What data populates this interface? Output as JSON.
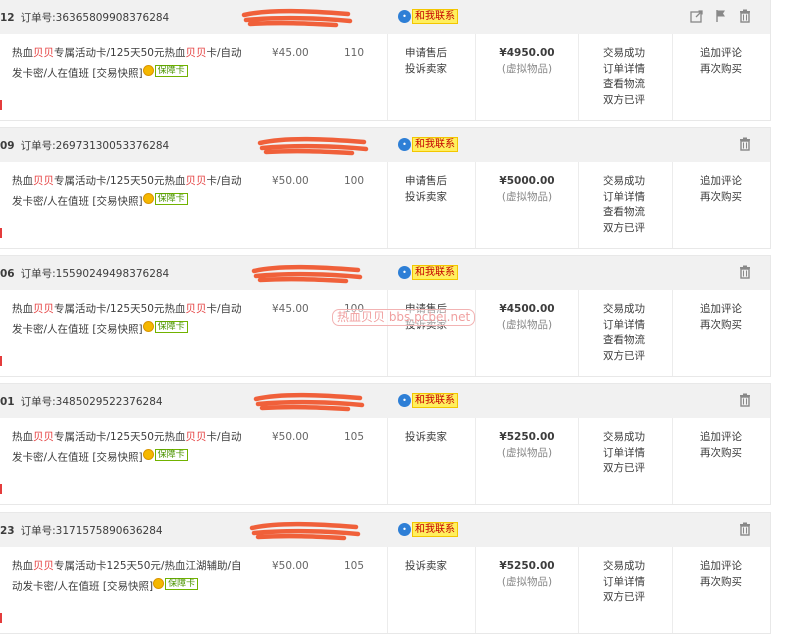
{
  "contact_label": "和我联系",
  "watermark": "热血贝贝 bbs.pcbei.net",
  "badge_label": "保障卡",
  "order_label": "订单号:",
  "orders": [
    {
      "date": "12",
      "order_no": "36365809908376284",
      "title_parts": [
        "热血",
        "贝贝",
        "专属活动卡/125天50元热血",
        "贝贝",
        "卡/自动发卡密/人在值班 [交易快照]"
      ],
      "price": "¥45.00",
      "qty": "110",
      "service": [
        "申请售后",
        "投诉卖家"
      ],
      "total": "¥4950.00",
      "total_note": "(虚拟物品)",
      "status": [
        "交易成功",
        "订单详情",
        "查看物流",
        "双方已评"
      ],
      "actions": [
        "追加评论",
        "再次购买"
      ]
    },
    {
      "date": "09",
      "order_no": "26973130053376284",
      "title_parts": [
        "热血",
        "贝贝",
        "专属活动卡/125天50元热血",
        "贝贝",
        "卡/自动发卡密/人在值班 [交易快照]"
      ],
      "price": "¥50.00",
      "qty": "100",
      "service": [
        "申请售后",
        "投诉卖家"
      ],
      "total": "¥5000.00",
      "total_note": "(虚拟物品)",
      "status": [
        "交易成功",
        "订单详情",
        "查看物流",
        "双方已评"
      ],
      "actions": [
        "追加评论",
        "再次购买"
      ]
    },
    {
      "date": "06",
      "order_no": "15590249498376284",
      "title_parts": [
        "热血",
        "贝贝",
        "专属活动卡/125天50元热血",
        "贝贝",
        "卡/自动发卡密/人在值班 [交易快照]"
      ],
      "price": "¥45.00",
      "qty": "100",
      "service": [
        "申请售后",
        "投诉卖家"
      ],
      "total": "¥4500.00",
      "total_note": "(虚拟物品)",
      "status": [
        "交易成功",
        "订单详情",
        "查看物流",
        "双方已评"
      ],
      "actions": [
        "追加评论",
        "再次购买"
      ]
    },
    {
      "date": "01",
      "order_no": "3485029522376284",
      "title_parts": [
        "热血",
        "贝贝",
        "专属活动卡/125天50元热血",
        "贝贝",
        "卡/自动发卡密/人在值班 [交易快照]"
      ],
      "price": "¥50.00",
      "qty": "105",
      "service": [
        "投诉卖家"
      ],
      "total": "¥5250.00",
      "total_note": "(虚拟物品)",
      "status": [
        "交易成功",
        "订单详情",
        "双方已评"
      ],
      "actions": [
        "追加评论",
        "再次购买"
      ]
    },
    {
      "date": "23",
      "order_no": "3171575890636284",
      "title_parts": [
        "热血",
        "贝贝",
        "专属活动卡125天50元/热血江湖辅助/自动发卡密/人在值班 [交易快照]",
        "",
        ""
      ],
      "price": "¥50.00",
      "qty": "105",
      "service": [
        "投诉卖家"
      ],
      "total": "¥5250.00",
      "total_note": "(虚拟物品)",
      "status": [
        "交易成功",
        "订单详情",
        "双方已评"
      ],
      "actions": [
        "追加评论",
        "再次购买"
      ]
    }
  ]
}
